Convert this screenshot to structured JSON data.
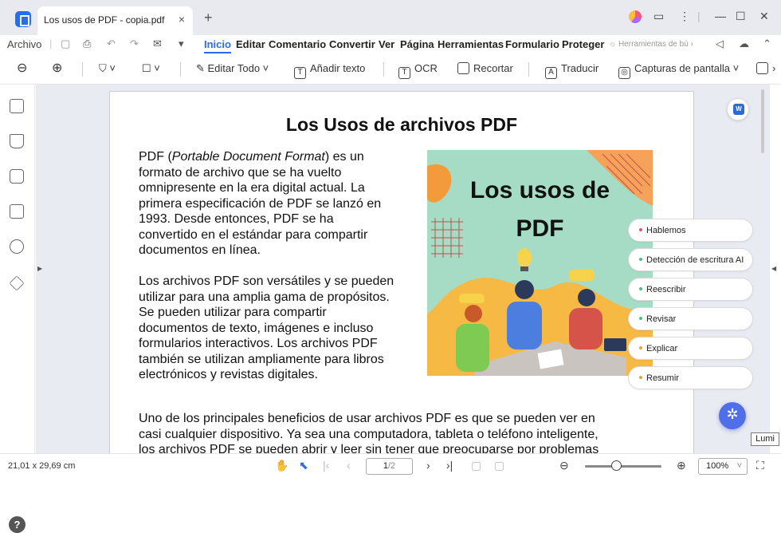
{
  "window": {
    "tab_title": "Los usos de PDF - copia.pdf",
    "new_tab": "+",
    "close": "×",
    "minimize": "—",
    "maximize": "☐",
    "close_window": "✕"
  },
  "menubar": {
    "file": "Archivo",
    "items": [
      "Inicio",
      "Editar",
      "Comentario",
      "Convertir",
      "Ver",
      "Página",
      "Herramientas",
      "Formulario",
      "Proteger"
    ],
    "tools_search": "Herramientas de bú"
  },
  "toolbar": {
    "edit_all": "Editar Todo",
    "add_text": "Añadir texto",
    "ocr": "OCR",
    "crop": "Recortar",
    "translate": "Traducir",
    "screenshot": "Capturas de pantalla"
  },
  "document": {
    "title": "Los Usos de archivos PDF",
    "para1_prefix": "PDF (",
    "para1_italic": "Portable Document Format",
    "para1_lines": [
      ") es un",
      "formato de archivo que se ha vuelto",
      "omnipresente en la era digital actual. La",
      "primera especificación de PDF se lanzó en",
      "1993. Desde entonces, PDF se ha",
      "convertido en el estándar para compartir",
      "documentos en línea."
    ],
    "para2_lines": [
      "Los archivos PDF son versátiles y se pueden",
      "utilizar para una amplia gama de propósitos.",
      "Se pueden utilizar para compartir",
      "documentos de texto, imágenes e incluso",
      "formularios interactivos. Los archivos PDF",
      "también se utilizan ampliamente para libros",
      "electrónicos y revistas digitales."
    ],
    "para3_lines": [
      "Uno de los principales beneficios de usar archivos PDF es que se pueden ver en",
      "casi cualquier dispositivo. Ya sea una computadora, tableta o teléfono inteligente,",
      "los archivos PDF se pueden abrir y leer sin tener que preocuparse por problemas"
    ],
    "image_title_lines": [
      "Los usos de",
      "PDF"
    ]
  },
  "ai_actions": [
    {
      "label": "Hablemos",
      "color": "#e0556b"
    },
    {
      "label": "Detección de escritura AI",
      "color": "#4cc07a"
    },
    {
      "label": "Reescribir",
      "color": "#4cc07a"
    },
    {
      "label": "Revisar",
      "color": "#4cc07a"
    },
    {
      "label": "Explicar",
      "color": "#f0a030"
    },
    {
      "label": "Resumir",
      "color": "#f0a030"
    }
  ],
  "lumi_tooltip": "Lumi",
  "statusbar": {
    "dimensions": "21,01 x 29,69 cm",
    "page_current": "1",
    "page_total": "/2",
    "zoom": "100%"
  }
}
